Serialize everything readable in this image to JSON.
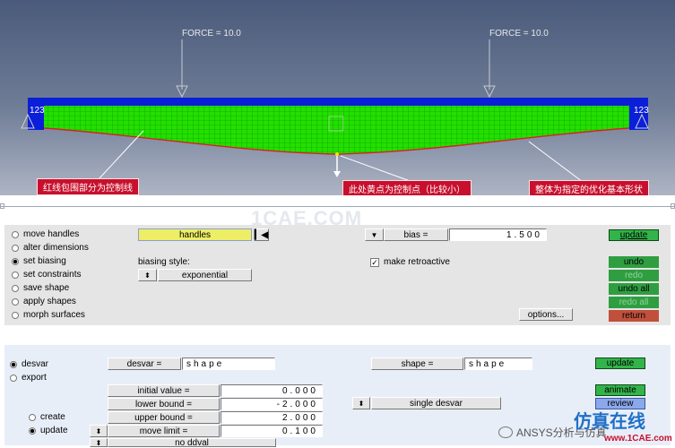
{
  "viewport": {
    "force_labels": [
      "FORCE = 10.0",
      "FORCE = 10.0"
    ],
    "corner_labels": [
      "123",
      "123"
    ],
    "callouts": [
      "红线包围部分为控制线",
      "此处黄点为控制点（比较小）",
      "整体为指定的优化基本形状"
    ],
    "colors": {
      "mesh": "#22e000",
      "support": "#0b1fd8",
      "callout": "#c8102e"
    }
  },
  "watermark": "1CAE.COM",
  "morph_panel": {
    "radios": [
      {
        "label": "move handles",
        "selected": false
      },
      {
        "label": "alter dimensions",
        "selected": false
      },
      {
        "label": "set biasing",
        "selected": true
      },
      {
        "label": "set constraints",
        "selected": false
      },
      {
        "label": "save shape",
        "selected": false
      },
      {
        "label": "apply shapes",
        "selected": false
      },
      {
        "label": "morph surfaces",
        "selected": false
      }
    ],
    "handles_button": "handles",
    "reset_icon": "first-icon",
    "bias_label": "bias =",
    "bias_value": "1.500",
    "biasing_style_label": "biasing style:",
    "biasing_style_value": "exponential",
    "make_retroactive": {
      "label": "make retroactive",
      "checked": true
    },
    "options_button": "options...",
    "side_buttons": {
      "update": "update",
      "undo": "undo",
      "redo": "redo",
      "undo_all": "undo all",
      "redo_all": "redo all",
      "return": "return"
    }
  },
  "desvar_panel": {
    "radios": [
      {
        "label": "desvar",
        "selected": true
      },
      {
        "label": "export",
        "selected": false
      }
    ],
    "sub_radios": [
      {
        "label": "create",
        "selected": false
      },
      {
        "label": "update",
        "selected": true
      }
    ],
    "desvar_label": "desvar =",
    "desvar_value": "shape",
    "shape_label": "shape =",
    "shape_value": "shape",
    "fields": [
      {
        "label": "initial value =",
        "value": "0.000"
      },
      {
        "label": "lower bound =",
        "value": "-2.000"
      },
      {
        "label": "upper bound =",
        "value": "2.000"
      },
      {
        "label": "move limit =",
        "value": "0.100"
      }
    ],
    "no_ddval": "no ddval",
    "single_desvar": "single desvar",
    "buttons": {
      "update": "update",
      "animate": "animate",
      "review": "review"
    }
  },
  "footer": {
    "wechat_text": "ANSYS分析与仿真",
    "logo_text": "仿真在线",
    "logo_url_text": "www.1CAE.com"
  }
}
